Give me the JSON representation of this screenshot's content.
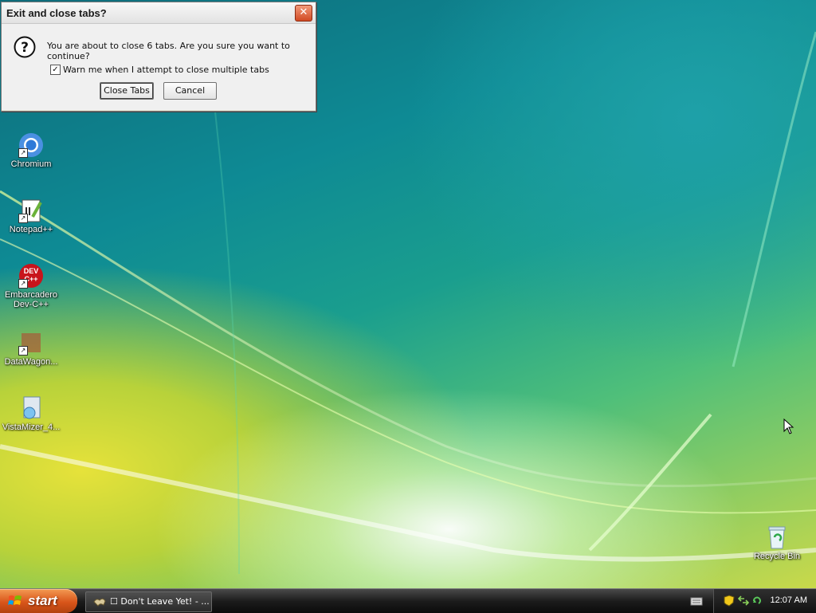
{
  "dialog": {
    "title": "Exit and close tabs?",
    "close_glyph": "✕",
    "message": "You are about to close 6 tabs. Are you sure you want to continue?",
    "checkbox_label": "Warn me when I attempt to close multiple tabs",
    "checkbox_checked": true,
    "checkbox_glyph": "✓",
    "close_tabs_label": "Close Tabs",
    "cancel_label": "Cancel"
  },
  "desktop": {
    "icons": [
      {
        "label": "Chromium",
        "icon": "chromium-icon"
      },
      {
        "label": "Notepad++",
        "icon": "notepad-plus-plus-icon"
      },
      {
        "label": "Embarcadero Dev-C++",
        "icon": "devcpp-icon",
        "logo_text": "DEV C++"
      },
      {
        "label": "DataWagon...",
        "icon": "datawagon-icon"
      },
      {
        "label": "VistaMizer_4...",
        "icon": "vistamizer-icon"
      }
    ],
    "recycle_bin_label": "Recycle Bin"
  },
  "taskbar": {
    "start_label": "start",
    "task_item_label": "☐ Don't Leave Yet! - ...",
    "clock": "12:07 AM"
  },
  "colors": {
    "start_orange": "#d9551a",
    "dialog_bg": "#f0f0f0",
    "close_red": "#d14a23"
  }
}
